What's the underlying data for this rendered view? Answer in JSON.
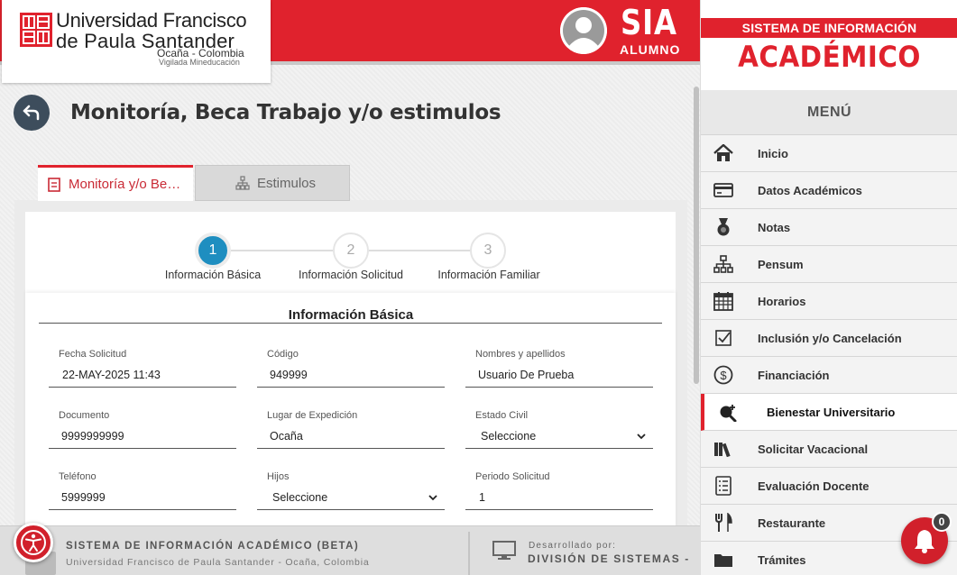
{
  "header": {
    "university_line1": "Universidad Francisco",
    "university_line2": "de Paula Santander",
    "university_line3": "Ocaña - Colombia",
    "university_line4": "Vigilada Mineducación",
    "app_title": "SIA",
    "app_subtitle": "ALUMNO"
  },
  "page": {
    "title": "Monitoría, Beca Trabajo y/o estimulos"
  },
  "tabs": [
    {
      "label": "Monitoría y/o Be…",
      "active": true
    },
    {
      "label": "Estimulos",
      "active": false
    }
  ],
  "stepper": [
    {
      "number": "1",
      "label": "Información Básica",
      "active": true
    },
    {
      "number": "2",
      "label": "Información Solicitud",
      "active": false
    },
    {
      "number": "3",
      "label": "Información Familiar",
      "active": false
    }
  ],
  "form": {
    "title": "Información Básica",
    "fields": [
      {
        "label": "Fecha Solicitud",
        "value": "22-MAY-2025 11:43"
      },
      {
        "label": "Código",
        "value": "949999"
      },
      {
        "label": "Nombres y apellidos",
        "value": "Usuario De Prueba"
      },
      {
        "label": "Documento",
        "value": "9999999999"
      },
      {
        "label": "Lugar de Expedición",
        "value": "Ocaña"
      },
      {
        "label": "Estado Civil",
        "value": "Seleccione"
      },
      {
        "label": "Teléfono",
        "value": "5999999"
      },
      {
        "label": "Hijos",
        "value": "Seleccione"
      },
      {
        "label": "Periodo Solicitud",
        "value": "1"
      }
    ]
  },
  "footer": {
    "system_name": "SISTEMA DE INFORMACIÓN ACADÉMICO (BETA)",
    "institution": "Universidad Francisco de Paula Santander - Ocaña, Colombia",
    "developed_by_label": "Desarrollado por:",
    "developer": "DIVISIÓN DE SISTEMAS -"
  },
  "sidebar": {
    "header_line1": "SISTEMA DE INFORMACIÓN",
    "header_line2": "ACADÉMICO",
    "menu_title": "MENÚ",
    "items": [
      {
        "label": "Inicio",
        "icon": "home-icon"
      },
      {
        "label": "Datos Académicos",
        "icon": "card-icon"
      },
      {
        "label": "Notas",
        "icon": "medal-icon"
      },
      {
        "label": "Pensum",
        "icon": "hierarchy-icon"
      },
      {
        "label": "Horarios",
        "icon": "calendar-icon"
      },
      {
        "label": "Inclusión y/o Cancelación",
        "icon": "checkbox-icon"
      },
      {
        "label": "Financiación",
        "icon": "dollar-icon"
      },
      {
        "label": "Bienestar Universitario",
        "icon": "search-plus-icon",
        "active": true
      },
      {
        "label": "Solicitar Vacacional",
        "icon": "books-icon"
      },
      {
        "label": "Evaluación Docente",
        "icon": "checklist-icon"
      },
      {
        "label": "Restaurante",
        "icon": "cutlery-icon"
      },
      {
        "label": "Trámites",
        "icon": "folder-icon"
      }
    ]
  },
  "notifications": {
    "count": "0"
  },
  "colors": {
    "brand_red": "#e0222d",
    "step_active": "#1e8ec0",
    "dark_slate": "#3d4d5c"
  }
}
